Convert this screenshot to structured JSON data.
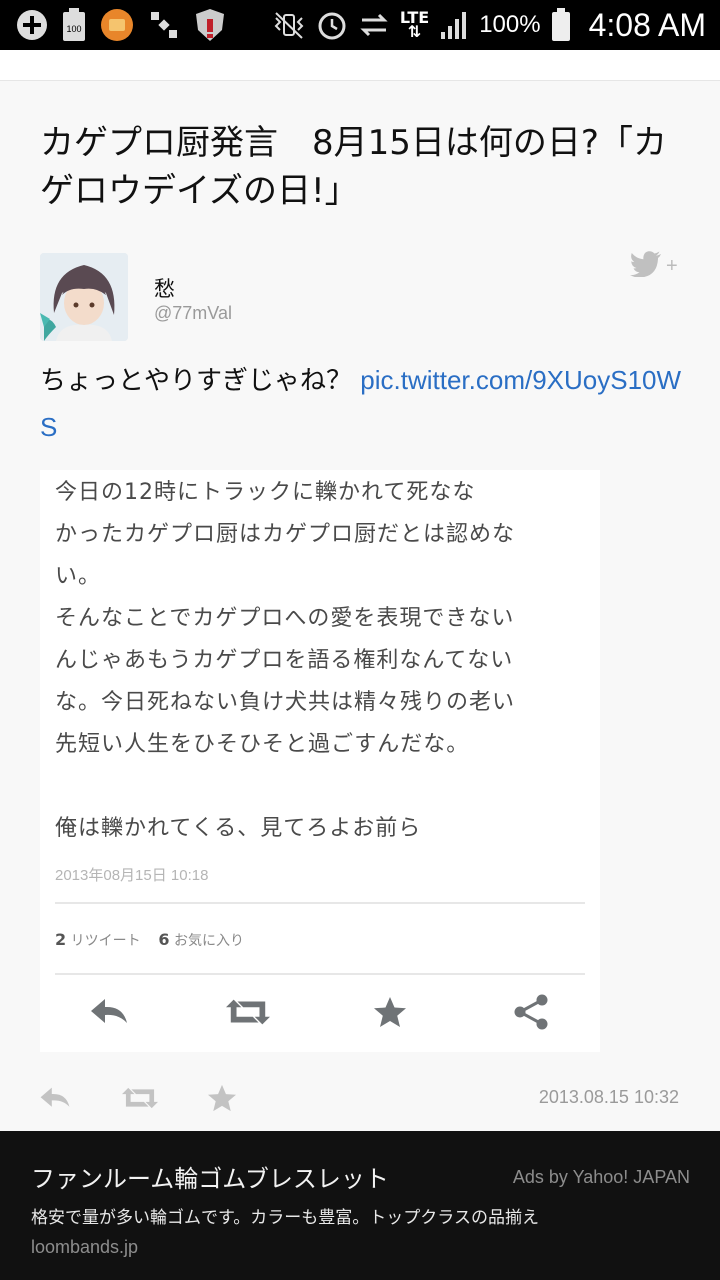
{
  "status_bar": {
    "battery_percent": "100%",
    "time": "4:08 AM",
    "network": "LTE",
    "icons": [
      "add-icon",
      "battery-100-icon",
      "orange-app-icon",
      "satellite-icon",
      "shield-alert-icon",
      "mute-vibrate-icon",
      "alarm-icon",
      "sync-icon",
      "lte-icon",
      "signal-icon",
      "battery-icon"
    ]
  },
  "article": {
    "title": "カゲプロ厨発言　8月15日は何の日?「カゲロウデイズの日!」"
  },
  "tweet": {
    "user_name": "愁",
    "user_handle": "@77mVal",
    "text": "ちょっとやりすぎじゃね？ ",
    "link": "pic.twitter.com/9XUoyS10WS",
    "timestamp": "2013.08.15 10:32",
    "follow_plus": "+",
    "actions": [
      "reply-icon",
      "retweet-icon",
      "favorite-icon"
    ]
  },
  "embedded_image": {
    "lines": [
      "今日の12時にトラックに轢かれて死なな",
      "かったカゲプロ厨はカゲプロ厨だとは認めな",
      "い。",
      "そんなことでカゲプロへの愛を表現できない",
      "んじゃあもうカゲプロを語る権利なんてない",
      "な。今日死ねない負け犬共は精々残りの老い",
      "先短い人生をひそひそと過ごすんだな。",
      "",
      "俺は轢かれてくる、見てろよお前ら"
    ],
    "date": "2013年08月15日 10:18",
    "retweet_count": "2",
    "retweet_label": "リツイート",
    "favorite_count": "6",
    "favorite_label": "お気に入り",
    "actions": [
      "reply-icon",
      "retweet-icon",
      "favorite-icon",
      "share-icon"
    ]
  },
  "ad": {
    "title": "ファンルーム輪ゴムブレスレット",
    "credit": "Ads by Yahoo! JAPAN",
    "description": "格安で量が多い輪ゴムです。カラーも豊富。トップクラスの品揃え",
    "domain": "loombands.jp"
  },
  "colors": {
    "link": "#2a6ec4",
    "status_bar_bg": "#000000",
    "ad_bg": "#111111"
  }
}
